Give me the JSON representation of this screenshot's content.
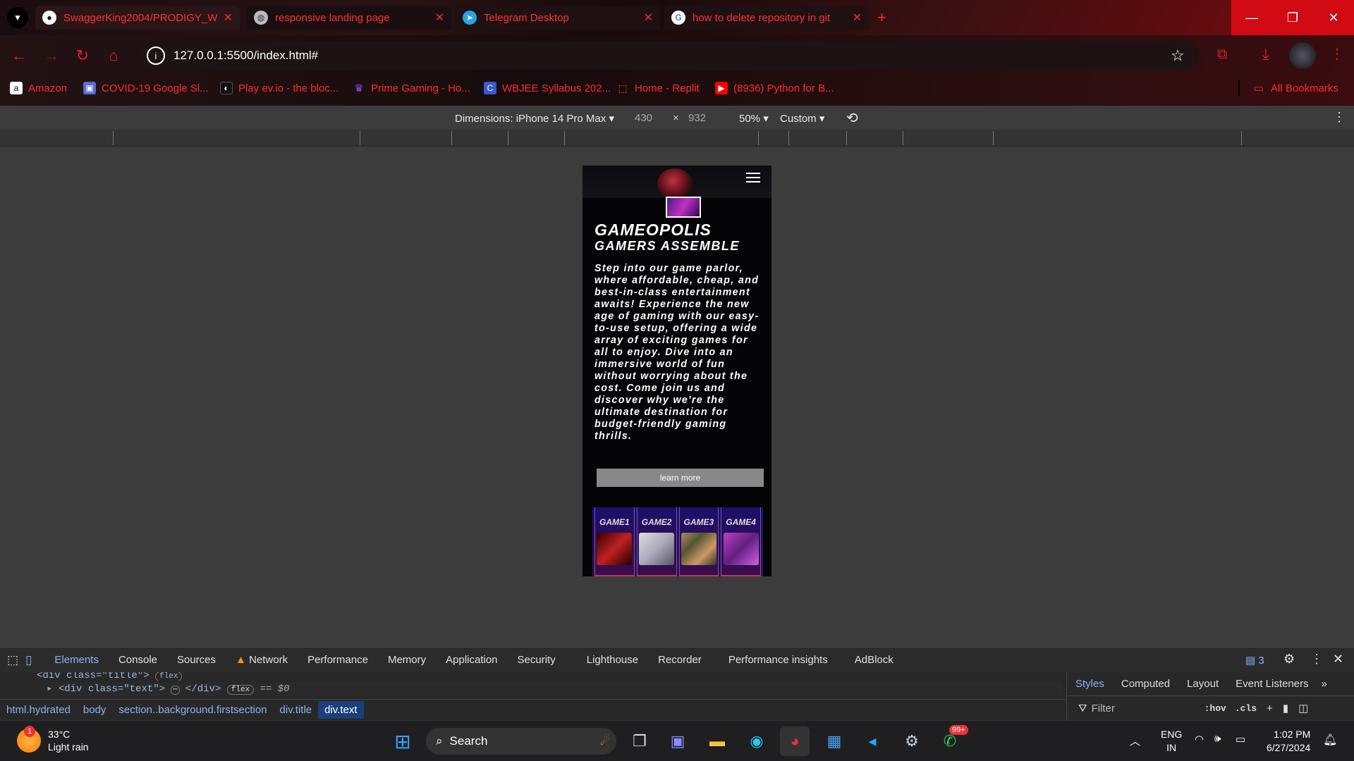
{
  "tabs": [
    {
      "title": "SwaggerKing2004/PRODIGY_W",
      "icon": "github-icon"
    },
    {
      "title": "responsive landing page",
      "icon": "globe-icon"
    },
    {
      "title": "Telegram Desktop",
      "icon": "telegram-icon"
    },
    {
      "title": "how to delete repository in git",
      "icon": "google-icon"
    }
  ],
  "address": {
    "url": "127.0.0.1:5500/index.html#"
  },
  "bookmarks": [
    {
      "label": "Amazon"
    },
    {
      "label": "COVID-19 Google Sl..."
    },
    {
      "label": "Play ev.io - the bloc..."
    },
    {
      "label": "Prime Gaming - Ho..."
    },
    {
      "label": "WBJEE Syllabus 202..."
    },
    {
      "label": "Home - Replit"
    },
    {
      "label": "(8936) Python for B..."
    }
  ],
  "all_bookmarks": "All Bookmarks",
  "device_toolbar": {
    "dimensions": "Dimensions: iPhone 14 Pro Max",
    "width": "430",
    "times": "×",
    "height": "932",
    "zoom": "50%",
    "throttle": "Custom"
  },
  "site": {
    "title": "GAMEOPOLIS",
    "subtitle": "GAMERS ASSEMBLE",
    "description": "Step into our game parlor, where affordable, cheap, and best-in-class entertainment awaits! Experience the new age of gaming with our easy-to-use setup, offering a wide array of exciting games for all to enjoy. Dive into an immersive world of fun without worrying about the cost. Come join us and discover why we're the ultimate destination for budget-friendly gaming thrills.",
    "learn_more": "learn more",
    "games": [
      "GAME1",
      "GAME2",
      "GAME3",
      "GAME4"
    ]
  },
  "devtools": {
    "tabs": [
      "Elements",
      "Console",
      "Sources",
      "Network",
      "Performance",
      "Memory",
      "Application",
      "Security",
      "Lighthouse",
      "Recorder",
      "Performance insights",
      "AdBlock"
    ],
    "issues_count": "3",
    "code_line1": "<div class=\"title\">",
    "code_line1_badge": "flex",
    "code_line2": "<div class=\"text\">",
    "code_line2_end": "</div>",
    "code_line2_badge": "flex",
    "code_line2_sel": "== $0",
    "breadcrumbs": [
      "html.hydrated",
      "body",
      "section..background.firstsection",
      "div.title",
      "div.text"
    ],
    "style_tabs": [
      "Styles",
      "Computed",
      "Layout",
      "Event Listeners"
    ],
    "filter_placeholder": "Filter",
    "hov": ":hov",
    "cls": ".cls"
  },
  "taskbar": {
    "weather_temp": "33°C",
    "weather_desc": "Light rain",
    "weather_badge": "1",
    "search": "Search",
    "lang": "ENG",
    "region": "IN",
    "time": "1:02 PM",
    "date": "6/27/2024",
    "whatsapp_badge": "99+"
  }
}
